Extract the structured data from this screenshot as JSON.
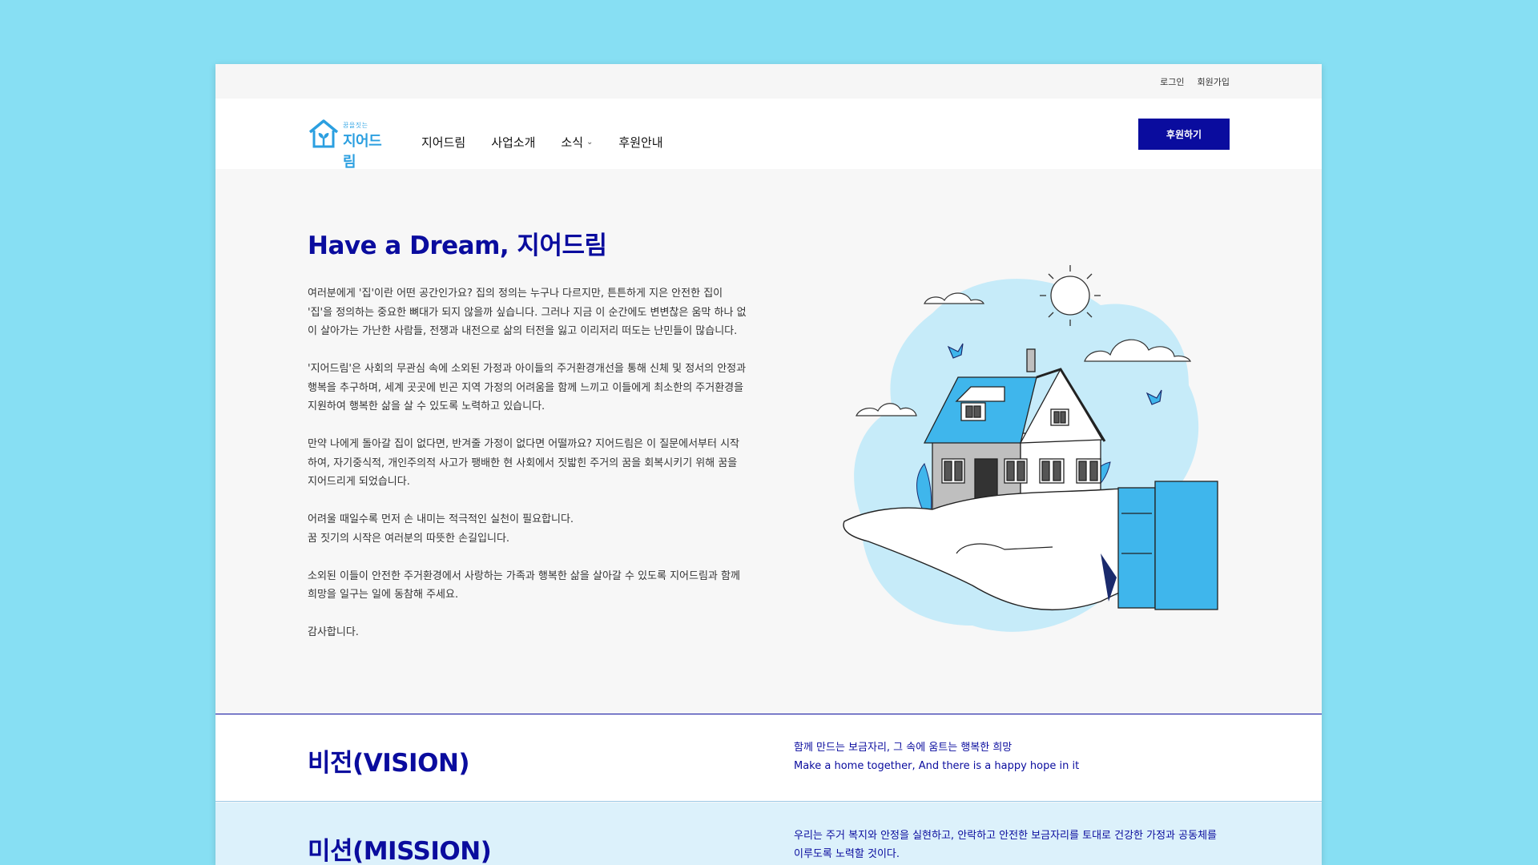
{
  "topbar": {
    "login": "로그인",
    "signup": "회원가입"
  },
  "logo": {
    "small": "꿈을짓는",
    "main": "지어드림"
  },
  "nav": [
    {
      "label": "지어드림"
    },
    {
      "label": "사업소개"
    },
    {
      "label": "소식"
    },
    {
      "label": "후원안내"
    }
  ],
  "donate_label": "후원하기",
  "hero": {
    "title": "Have a Dream, 지어드림",
    "paragraphs": [
      "여러분에게 '집'이란 어떤 공간인가요? 집의 정의는 누구나 다르지만, 튼튼하게 지은 안전한 집이\n'집'을 정의하는 중요한 뼈대가 되지 않을까 싶습니다. 그러나 지금 이 순간에도 변변찮은 움막 하나 없\n이 살아가는 가난한 사람들, 전쟁과 내전으로 삶의 터전을 잃고 이리저리 떠도는 난민들이 많습니다.",
      "'지어드림'은 사회의 무관심 속에 소외된 가정과 아이들의 주거환경개선을 통해 신체 및 정서의 안정과\n행복을 추구하며, 세계 곳곳에 빈곤 지역 가정의 어려움을 함께 느끼고 이들에게 최소한의 주거환경을\n지원하여 행복한 삶을 살 수 있도록 노력하고 있습니다.",
      "만약 나에게 돌아갈 집이 없다면, 반겨줄 가정이 없다면 어떨까요? 지어드림은 이 질문에서부터 시작\n하여, 자기중식적, 개인주의적 사고가 팽배한 현 사회에서 짓밟힌 주거의 꿈을 회복시키기 위해 꿈을\n지어드리게 되었습니다.",
      "어려울 때일수록 먼저 손 내미는 적극적인 실천이 필요합니다.\n꿈 짓기의 시작은 여러분의 따뜻한 손길입니다.",
      "소외된 이들이 안전한 주거환경에서 사랑하는 가족과 행복한 삶을 살아갈 수 있도록 지어드림과 함께\n희망을 일구는 일에 동참해 주세요.",
      "감사합니다."
    ]
  },
  "vision": {
    "title": "비전(VISION)",
    "text": "함께 만드는 보금자리, 그 속에 움트는 행복한 희망\nMake a home together, And there is a happy hope in it"
  },
  "mission": {
    "title": "미션(MISSION)",
    "text": "우리는 주거 복지와 안정을 실현하고, 안락하고 안전한 보금자리를 토대로 건강한 가정과 공동체를\n이루도록 노력할 것이다."
  },
  "colors": {
    "navy": "#0a0c9e",
    "sky": "#87dff3",
    "light_blue": "#c6ebf9",
    "blue": "#3fb6ec"
  }
}
